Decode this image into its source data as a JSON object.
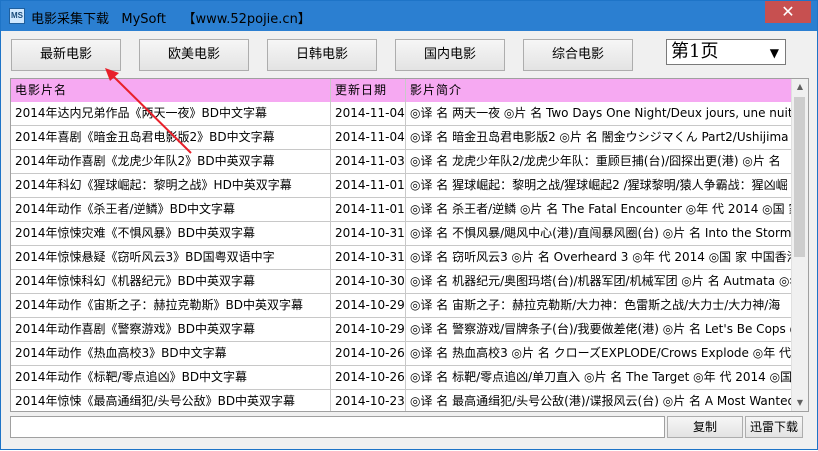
{
  "window": {
    "title": "电影采集下载   MySoft    【www.52pojie.cn】",
    "icon_label": "MS",
    "close_glyph": "✕"
  },
  "toolbar": {
    "buttons": [
      "最新电影",
      "欧美电影",
      "日韩电影",
      "国内电影",
      "综合电影"
    ],
    "page_select": "第1页"
  },
  "grid": {
    "headers": [
      "电影片名",
      "更新日期",
      "影片简介"
    ],
    "rows": [
      {
        "name": "2014年达内兄弟作品《两天一夜》BD中文字幕",
        "date": "2014-11-04",
        "desc": "◎译 名 两天一夜 ◎片 名 Two Days One Night/Deux jours, une nuit"
      },
      {
        "name": "2014年喜剧《暗金丑岛君电影版2》BD中文字幕",
        "date": "2014-11-04",
        "desc": "◎译 名 暗金丑岛君电影版2 ◎片 名 闇金ウシジマくん Part2/Ushijima"
      },
      {
        "name": "2014年动作喜剧《龙虎少年队2》BD中英双字幕",
        "date": "2014-11-03",
        "desc": "◎译 名 龙虎少年队2/龙虎少年队：重顾巨捕(台)/囧探出更(港) ◎片 名"
      },
      {
        "name": "2014年科幻《猩球崛起：黎明之战》HD中英双字幕",
        "date": "2014-11-01",
        "desc": "◎译 名 猩球崛起：黎明之战/猩球崛起2 /猩球黎明/猿人争霸战：猩凶崛"
      },
      {
        "name": "2014年动作《杀王者/逆鳞》BD中文字幕",
        "date": "2014-11-01",
        "desc": "◎译 名 杀王者/逆鳞 ◎片 名 The Fatal Encounter ◎年 代 2014 ◎国 家"
      },
      {
        "name": "2014年惊悚灾难《不惧风暴》BD中英双字幕",
        "date": "2014-10-31",
        "desc": "◎译 名 不惧风暴/飓风中心(港)/直闯暴风圈(台) ◎片 名 Into the Storm"
      },
      {
        "name": "2014年惊悚悬疑《窃听风云3》BD国粤双语中字",
        "date": "2014-10-31",
        "desc": "◎译 名 窃听风云3 ◎片 名 Overheard 3 ◎年 代 2014 ◎国 家 中国香港,"
      },
      {
        "name": "2014年惊悚科幻《机器纪元》BD中英双字幕",
        "date": "2014-10-30",
        "desc": "◎译 名 机器纪元/奥图玛塔(台)/机器军团/机械军团 ◎片 名 Autmata ◎年"
      },
      {
        "name": "2014年动作《宙斯之子：赫拉克勒斯》BD中英双字幕",
        "date": "2014-10-29",
        "desc": "◎译 名 宙斯之子：赫拉克勒斯/大力神：色雷斯之战/大力士/大力神/海"
      },
      {
        "name": "2014年动作喜剧《警察游戏》BD中英双字幕",
        "date": "2014-10-29",
        "desc": "◎译 名 警察游戏/冒牌条子(台)/我要做差佬(港) ◎片 名 Let's Be Cops ◎"
      },
      {
        "name": "2014年动作《热血高校3》BD中文字幕",
        "date": "2014-10-26",
        "desc": "◎译 名 热血高校3 ◎片 名 クローズEXPLODE/Crows Explode ◎年 代"
      },
      {
        "name": "2014年动作《标靶/零点追凶》BD中文字幕",
        "date": "2014-10-26",
        "desc": "◎译 名 标靶/零点追凶/单刀直入 ◎片 名 The Target ◎年 代 2014 ◎国"
      },
      {
        "name": "2014年惊悚《最高通缉犯/头号公敌》BD中英双字幕",
        "date": "2014-10-23",
        "desc": "◎译 名 最高通缉犯/头号公敌(港)/谍报风云(台) ◎片 名 A Most Wanted"
      }
    ]
  },
  "scrollbar": {
    "up": "▲",
    "down": "▼"
  },
  "bottom": {
    "url_value": "",
    "copy_button": "复制",
    "download_button": "迅雷下载"
  },
  "colors": {
    "header_bg": "#f6a9f2",
    "titlebar": "#2b7fd1",
    "close": "#c75050",
    "annotation_arrow": "#e8202a"
  }
}
